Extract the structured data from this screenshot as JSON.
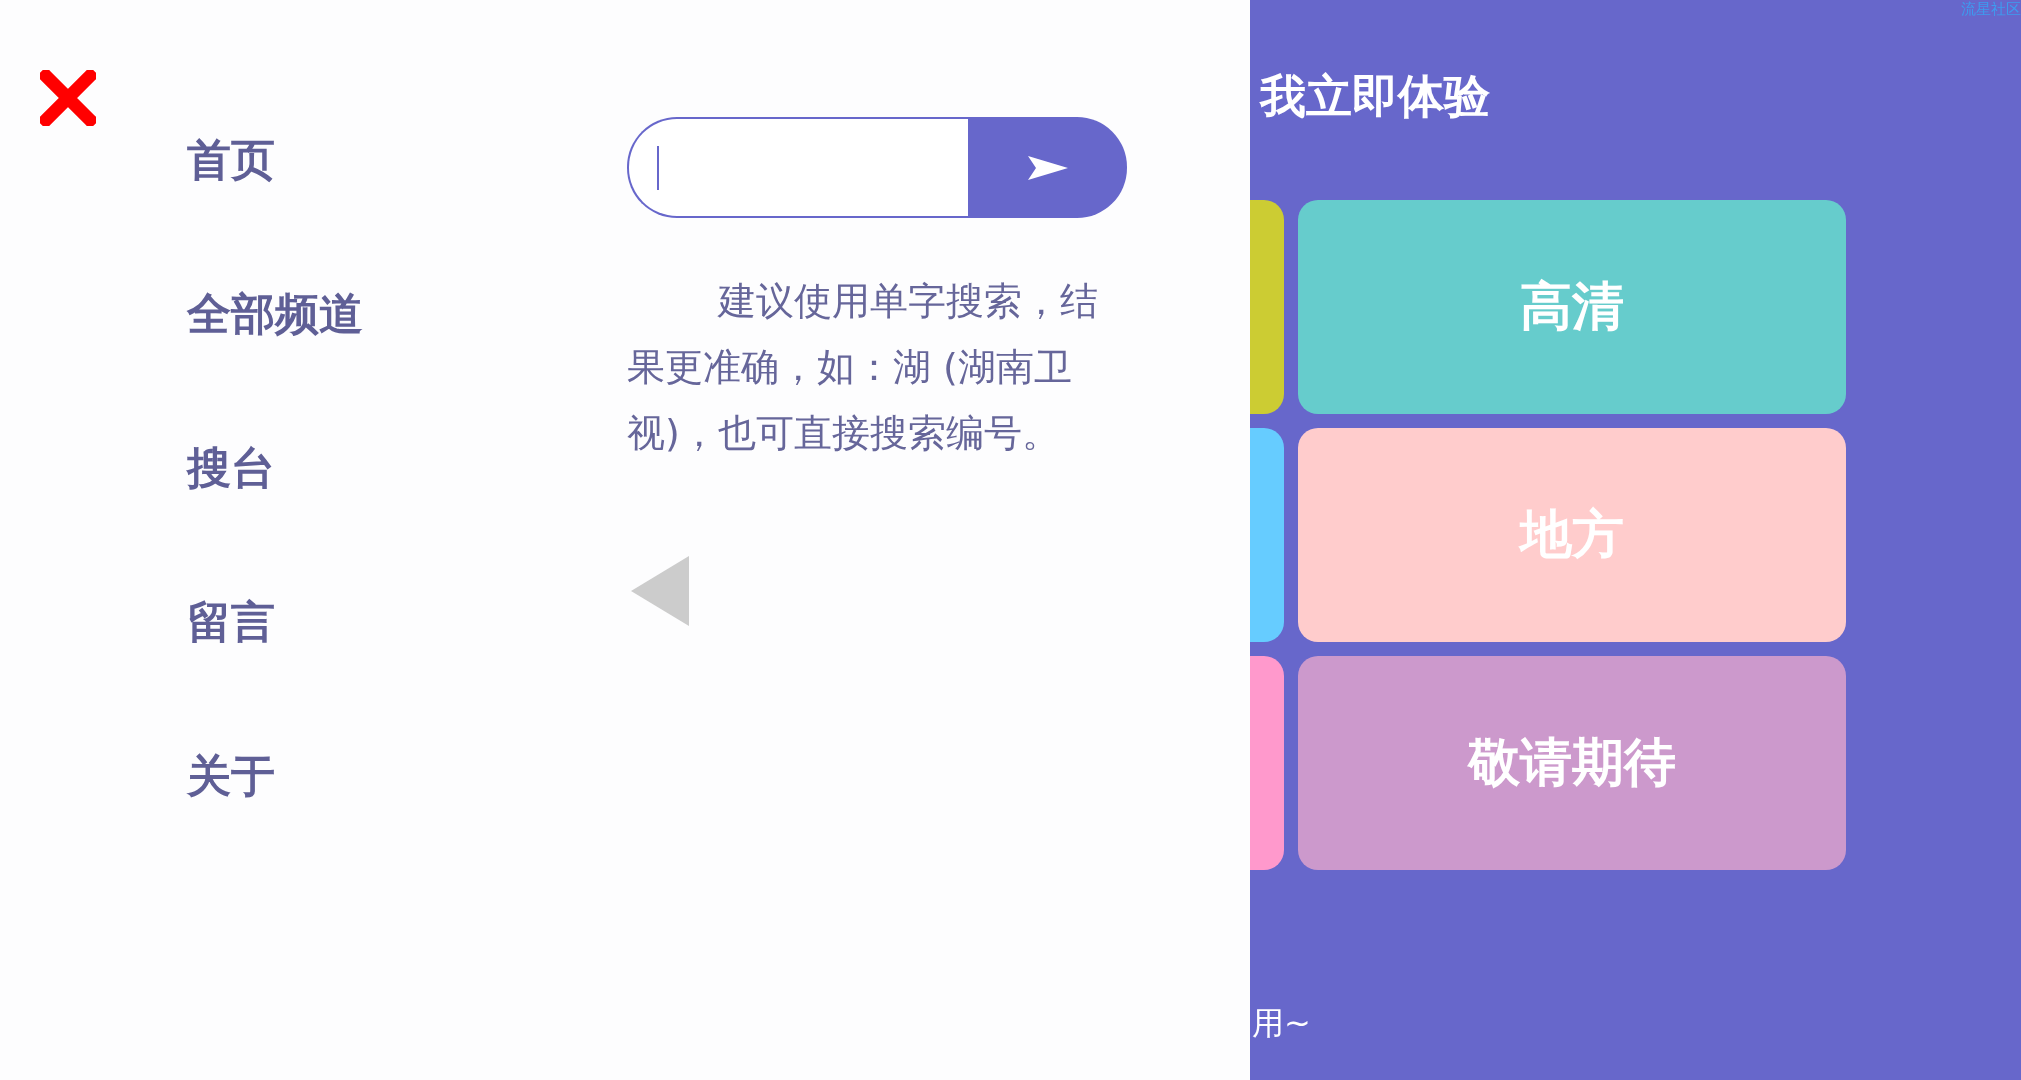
{
  "menu": {
    "items": [
      {
        "label": "首页"
      },
      {
        "label": "全部频道"
      },
      {
        "label": "搜台"
      },
      {
        "label": "留言"
      },
      {
        "label": "关于"
      }
    ]
  },
  "search": {
    "hint": "建议使用单字搜索，结果更准确，如：湖 (湖南卫视)，也可直接搜索编号。"
  },
  "background": {
    "corner_link": "流星社区",
    "banner": "我立即体验",
    "strips": [
      {
        "color": "#cccc33"
      },
      {
        "color": "#66ccff"
      },
      {
        "color": "#ff99cc"
      }
    ],
    "tiles": [
      {
        "label": "高清",
        "color": "#66cccc"
      },
      {
        "label": "地方",
        "color": "#ffcccc"
      },
      {
        "label": "敬请期待",
        "color": "#cc99cc"
      }
    ],
    "footer": "用~"
  }
}
